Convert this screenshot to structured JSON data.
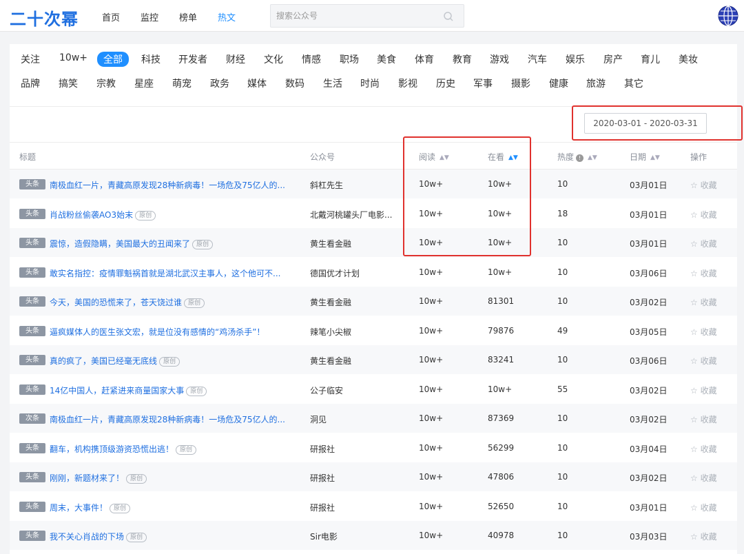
{
  "nav": {
    "logo": "二十次幂",
    "items": [
      "首页",
      "监控",
      "榜单",
      "热文"
    ],
    "active_index": 3,
    "search_placeholder": "搜索公众号"
  },
  "categories": {
    "row1": [
      "关注",
      "10w+",
      "全部",
      "科技",
      "开发者",
      "财经",
      "文化",
      "情感",
      "职场",
      "美食",
      "体育",
      "教育",
      "游戏",
      "汽车",
      "娱乐",
      "房产",
      "育儿",
      "美妆"
    ],
    "row2": [
      "品牌",
      "搞笑",
      "宗教",
      "星座",
      "萌宠",
      "政务",
      "媒体",
      "数码",
      "生活",
      "时尚",
      "影视",
      "历史",
      "军事",
      "摄影",
      "健康",
      "旅游",
      "其它"
    ],
    "active": "全部"
  },
  "date_range": "2020-03-01 - 2020-03-31",
  "table": {
    "headers": {
      "title": "标题",
      "account": "公众号",
      "read": "阅读",
      "watch": "在看",
      "heat": "热度",
      "date": "日期",
      "op": "操作"
    },
    "original_badge": "原创",
    "favorite_label": "☆ 收藏",
    "rows": [
      {
        "tag": "头条",
        "title": "南极血红一片，青藏高原发现28种新病毒！一场危及75亿人的...",
        "original": false,
        "account": "斜杠先生",
        "read": "10w+",
        "watch": "10w+",
        "heat": "10",
        "date": "03月01日"
      },
      {
        "tag": "头条",
        "title": "肖战粉丝偷袭AO3始末",
        "original": true,
        "account": "北戴河桃罐头厂电影...",
        "read": "10w+",
        "watch": "10w+",
        "heat": "18",
        "date": "03月01日"
      },
      {
        "tag": "头条",
        "title": "震惊，造假隐瞒，美国最大的丑闻来了",
        "original": true,
        "account": "黄生看金融",
        "read": "10w+",
        "watch": "10w+",
        "heat": "10",
        "date": "03月01日"
      },
      {
        "tag": "头条",
        "title": "敢实名指控：疫情罪魁祸首就是湖北武汉主事人，这个他可不...",
        "original": false,
        "account": "德国优才计划",
        "read": "10w+",
        "watch": "10w+",
        "heat": "10",
        "date": "03月06日"
      },
      {
        "tag": "头条",
        "title": "今天，美国的恐慌来了，苍天饶过谁",
        "original": true,
        "account": "黄生看金融",
        "read": "10w+",
        "watch": "81301",
        "heat": "10",
        "date": "03月02日"
      },
      {
        "tag": "头条",
        "title": "逼疯媒体人的医生张文宏，就是位没有感情的“鸡汤杀手”！",
        "original": false,
        "account": "辣笔小尖椒",
        "read": "10w+",
        "watch": "79876",
        "heat": "49",
        "date": "03月05日"
      },
      {
        "tag": "头条",
        "title": "真的疯了，美国已经毫无底线",
        "original": true,
        "account": "黄生看金融",
        "read": "10w+",
        "watch": "83241",
        "heat": "10",
        "date": "03月06日"
      },
      {
        "tag": "头条",
        "title": "14亿中国人，赶紧进来商量国家大事",
        "original": true,
        "account": "公子临安",
        "read": "10w+",
        "watch": "10w+",
        "heat": "55",
        "date": "03月02日"
      },
      {
        "tag": "次条",
        "title": "南极血红一片，青藏高原发现28种新病毒！一场危及75亿人的...",
        "original": false,
        "account": "洞见",
        "read": "10w+",
        "watch": "87369",
        "heat": "10",
        "date": "03月02日"
      },
      {
        "tag": "头条",
        "title": "翻车，机构携顶级游资恐慌出逃！",
        "original": true,
        "account": "研报社",
        "read": "10w+",
        "watch": "56299",
        "heat": "10",
        "date": "03月04日"
      },
      {
        "tag": "头条",
        "title": "刚刚，新题材来了！",
        "original": true,
        "account": "研报社",
        "read": "10w+",
        "watch": "47806",
        "heat": "10",
        "date": "03月02日"
      },
      {
        "tag": "头条",
        "title": "周末，大事件！",
        "original": true,
        "account": "研报社",
        "read": "10w+",
        "watch": "52650",
        "heat": "10",
        "date": "03月01日"
      },
      {
        "tag": "头条",
        "title": "我不关心肖战的下场",
        "original": true,
        "account": "Sir电影",
        "read": "10w+",
        "watch": "40978",
        "heat": "10",
        "date": "03月03日"
      }
    ]
  },
  "colors": {
    "accent": "#1f8fff",
    "link": "#1f6fe0",
    "highlight_box": "#e0312d"
  },
  "icons": {
    "search": "search-icon",
    "avatar": "globe-avatar-icon",
    "sort": "sort-caret-icon"
  }
}
